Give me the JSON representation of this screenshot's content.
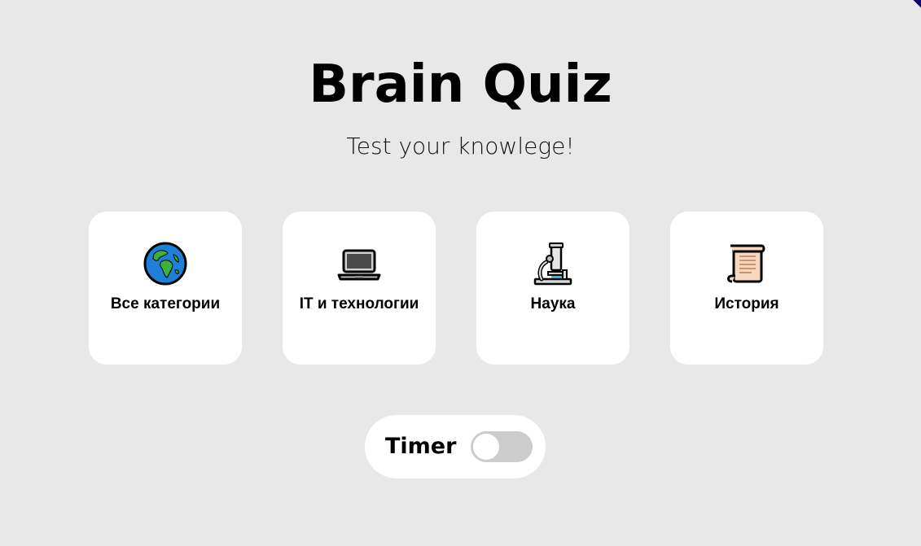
{
  "header": {
    "title": "Brain Quiz",
    "subtitle": "Test your knowlege!"
  },
  "categories": [
    {
      "label": "Все категории",
      "icon": "globe-icon"
    },
    {
      "label": "IT и технологии",
      "icon": "laptop-icon"
    },
    {
      "label": "Наука",
      "icon": "microscope-icon"
    },
    {
      "label": "История",
      "icon": "scroll-icon"
    }
  ],
  "timer": {
    "label": "Timer",
    "enabled": false
  },
  "colors": {
    "background": "#e8e8e8",
    "card": "#ffffff",
    "toggle_off": "#cccccc"
  }
}
